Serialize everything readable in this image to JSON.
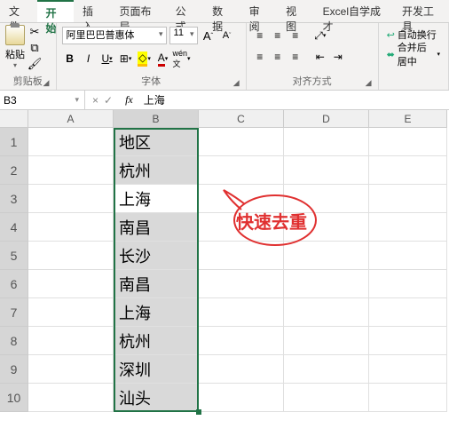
{
  "tabs": [
    "文件",
    "开始",
    "插入",
    "页面布局",
    "公式",
    "数据",
    "审阅",
    "视图",
    "Excel自学成才",
    "开发工具"
  ],
  "active_tab": 1,
  "clipboard": {
    "paste": "粘贴",
    "title": "剪贴板"
  },
  "font": {
    "name": "阿里巴巴普惠体",
    "size": "11",
    "inc_hint": "A↑",
    "dec_hint": "A↓",
    "bold": "B",
    "italic": "I",
    "underline": "U",
    "title": "字体"
  },
  "align": {
    "title": "对齐方式",
    "wrap": "自动换行",
    "merge": "合并后居中"
  },
  "namebox": "B3",
  "formula": "上海",
  "columns": [
    "A",
    "B",
    "C",
    "D",
    "E"
  ],
  "rows": [
    1,
    2,
    3,
    4,
    5,
    6,
    7,
    8,
    9,
    10
  ],
  "data_b": [
    "地区",
    "杭州",
    "上海",
    "南昌",
    "长沙",
    "南昌",
    "上海",
    "杭州",
    "深圳",
    "汕头"
  ],
  "active_cell": {
    "row": 3,
    "col": "B"
  },
  "annotation": "快速去重"
}
